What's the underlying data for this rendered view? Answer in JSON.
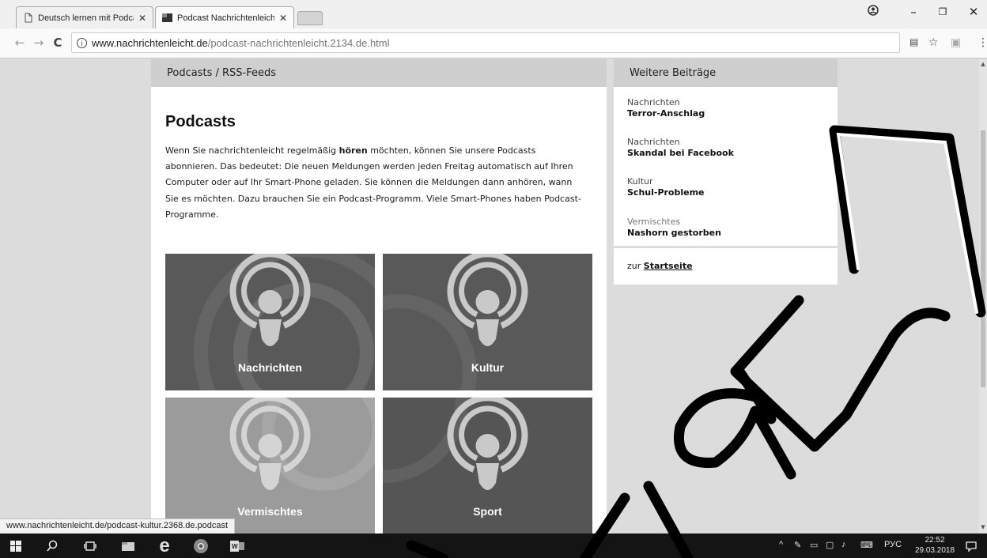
{
  "browser": {
    "tabs": [
      {
        "title": "Deutsch lernen mit Podca",
        "active": false
      },
      {
        "title": "Podcast Nachrichtenleich",
        "active": true
      }
    ],
    "address": {
      "host": "www.nachrichtenleicht.de",
      "path": "/podcast-nachrichtenleicht.2134.de.html"
    },
    "status_url": "www.nachrichtenleicht.de/podcast-kultur.2368.de.podcast"
  },
  "main": {
    "section_header": "Podcasts / RSS-Feeds",
    "title": "Podcasts",
    "intro_before": "Wenn Sie nachrichtenleicht regelmäßig ",
    "intro_bold": "hören",
    "intro_after": " möchten, können Sie unsere Podcasts abonnieren. Das bedeutet: Die neuen Meldungen werden jeden Freitag automatisch auf Ihren Computer oder auf Ihr Smart-Phone geladen. Sie können die Meldungen dann anhören, wann Sie es möchten. Dazu brauchen Sie ein Podcast-Programm. Viele Smart-Phones haben Podcast-Programme.",
    "tiles": [
      {
        "label": "Nachrichten",
        "color": "#595959"
      },
      {
        "label": "Kultur",
        "color": "#595959"
      },
      {
        "label": "Vermischtes",
        "color": "#9b9b9b"
      },
      {
        "label": "Sport",
        "color": "#555555"
      }
    ]
  },
  "sidebar": {
    "header": "Weitere Beiträge",
    "items": [
      {
        "category": "Nachrichten",
        "title": "Terror-Anschlag"
      },
      {
        "category": "Nachrichten",
        "title": "Skandal bei Facebook"
      },
      {
        "category": "Kultur",
        "title": "Schul-Probleme"
      },
      {
        "category": "Vermischtes",
        "title": "Nashorn gestorben"
      }
    ],
    "home_prefix": "zur ",
    "home_link": "Startseite"
  },
  "taskbar": {
    "language": "РУС",
    "time": "22:52",
    "date": "29.03.2018"
  }
}
